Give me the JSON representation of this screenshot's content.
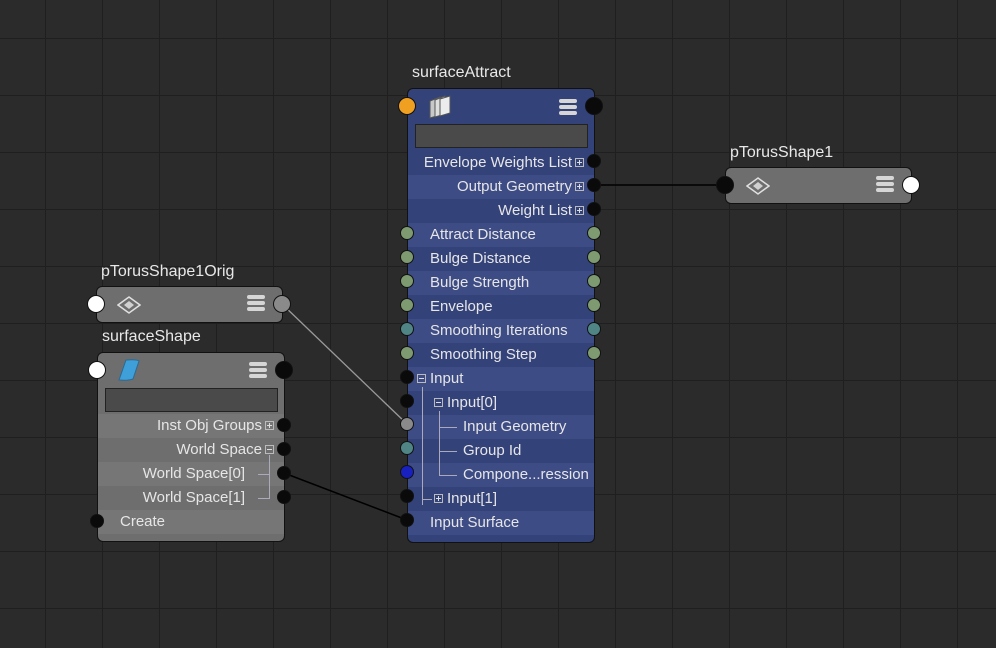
{
  "nodes": {
    "surface_attract": {
      "title": "surfaceAttract",
      "attributes": [
        {
          "label": "Envelope Weights List"
        },
        {
          "label": "Output Geometry"
        },
        {
          "label": "Weight List"
        },
        {
          "label": "Attract Distance"
        },
        {
          "label": "Bulge Distance"
        },
        {
          "label": "Bulge Strength"
        },
        {
          "label": "Envelope"
        },
        {
          "label": "Smoothing Iterations"
        },
        {
          "label": "Smoothing Step"
        },
        {
          "label": "Input"
        },
        {
          "label": "Input[0]"
        },
        {
          "label": "Input Geometry"
        },
        {
          "label": "Group Id"
        },
        {
          "label": "Compone...ression"
        },
        {
          "label": "Input[1]"
        },
        {
          "label": "Input Surface"
        }
      ]
    },
    "ptorus_shape1": {
      "title": "pTorusShape1"
    },
    "ptorus_shape1_orig": {
      "title": "pTorusShape1Orig"
    },
    "surface_shape": {
      "title": "surfaceShape",
      "attributes": [
        {
          "label": "Inst Obj Groups"
        },
        {
          "label": "World Space"
        },
        {
          "label": "World Space[0]"
        },
        {
          "label": "World Space[1]"
        },
        {
          "label": "Create"
        }
      ]
    }
  },
  "colors": {
    "background": "#2b2b2b",
    "grid_line": "#1f1f1f",
    "blue_node": "#34427a",
    "gray_node": "#6e6e6e",
    "selected_port": "#f0a020",
    "attr_port_green": "#7e9a70",
    "attr_port_teal": "#4f8585"
  },
  "icons": {
    "deformer": "deformer-icon",
    "mesh": "mesh-shape-icon",
    "nurbs_surface": "nurbs-surface-icon",
    "attribute_menu": "attribute-display-menu-icon"
  }
}
